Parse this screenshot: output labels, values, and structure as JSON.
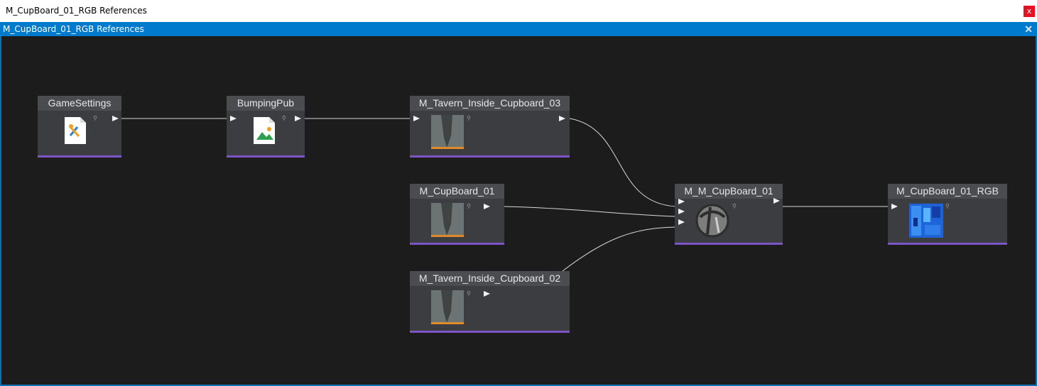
{
  "window": {
    "title": "M_CupBoard_01_RGB References",
    "close_label": "x"
  },
  "tab": {
    "title": "M_CupBoard_01_RGB References",
    "close_label": "✕"
  },
  "nodes": {
    "gamesettings": {
      "title": "GameSettings",
      "icon": "settings-asset-icon"
    },
    "bumpingpub": {
      "title": "BumpingPub",
      "icon": "scene-asset-icon"
    },
    "tavern03": {
      "title": "M_Tavern_Inside_Cupboard_03",
      "icon": "material-thumbnail"
    },
    "cupboard01": {
      "title": "M_CupBoard_01",
      "icon": "material-thumbnail"
    },
    "tavern02": {
      "title": "M_Tavern_Inside_Cupboard_02",
      "icon": "material-thumbnail"
    },
    "mm_cupboard01": {
      "title": "M_M_CupBoard_01",
      "icon": "material-sphere-thumbnail"
    },
    "cupboard01_rgb": {
      "title": "M_CupBoard_01_RGB",
      "icon": "texture-thumbnail"
    }
  },
  "colors": {
    "canvas_bg": "#1c1c1c",
    "node_bg": "#3c3d41",
    "node_header": "#4b4c50",
    "node_accent": "#7c56c7",
    "wire": "#d9d9d9",
    "tab_accent": "#007acc"
  }
}
